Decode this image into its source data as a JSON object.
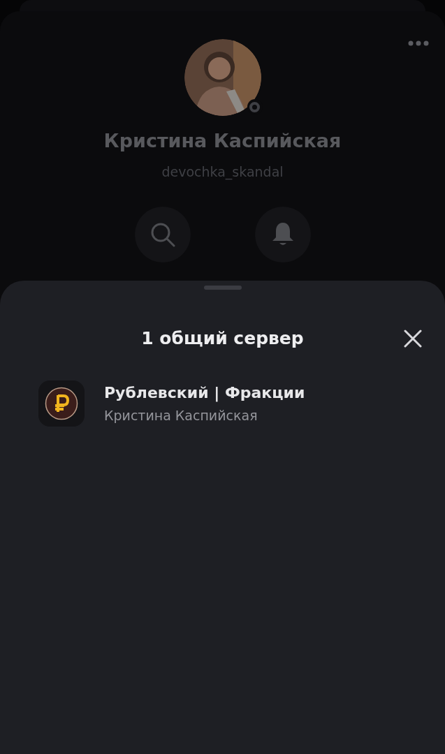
{
  "profile": {
    "display_name": "Кристина Каспийская",
    "username": "devochka_skandal",
    "online": false
  },
  "sheet": {
    "title": "1 общий сервер"
  },
  "servers": [
    {
      "name": "Рублевский | Фракции",
      "nickname": "Кристина Каспийская"
    }
  ]
}
